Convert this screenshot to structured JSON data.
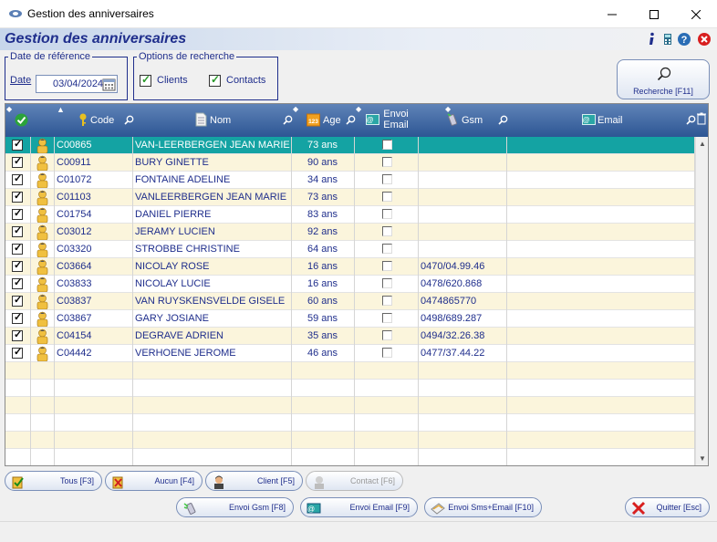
{
  "window": {
    "title": "Gestion des anniversaires"
  },
  "header": {
    "title": "Gestion des anniversaires"
  },
  "reference": {
    "legend": "Date de référence",
    "date_label": "Date",
    "date_value": "03/04/2024"
  },
  "options": {
    "legend": "Options de recherche",
    "clients_label": "Clients",
    "clients_checked": true,
    "contacts_label": "Contacts",
    "contacts_checked": true
  },
  "search_button": {
    "label": "Recherche [F11]"
  },
  "grid": {
    "columns": {
      "code": "Code",
      "nom": "Nom",
      "age": "Age",
      "envoi_email": "Envoi Email",
      "gsm": "Gsm",
      "email": "Email"
    },
    "rows": [
      {
        "checked": true,
        "code": "C00865",
        "nom": "VAN-LEERBERGEN JEAN MARIE",
        "age": "73 ans",
        "gsm": "",
        "email": ""
      },
      {
        "checked": true,
        "code": "C00911",
        "nom": "BURY GINETTE",
        "age": "90 ans",
        "gsm": "",
        "email": ""
      },
      {
        "checked": true,
        "code": "C01072",
        "nom": "FONTAINE ADELINE",
        "age": "34 ans",
        "gsm": "",
        "email": ""
      },
      {
        "checked": true,
        "code": "C01103",
        "nom": "VANLEERBERGEN JEAN MARIE",
        "age": "73 ans",
        "gsm": "",
        "email": ""
      },
      {
        "checked": true,
        "code": "C01754",
        "nom": "DANIEL PIERRE",
        "age": "83 ans",
        "gsm": "",
        "email": ""
      },
      {
        "checked": true,
        "code": "C03012",
        "nom": "JERAMY LUCIEN",
        "age": "92 ans",
        "gsm": "",
        "email": ""
      },
      {
        "checked": true,
        "code": "C03320",
        "nom": "STROBBE CHRISTINE",
        "age": "64 ans",
        "gsm": "",
        "email": ""
      },
      {
        "checked": true,
        "code": "C03664",
        "nom": "NICOLAY ROSE",
        "age": "16 ans",
        "gsm": "0470/04.99.46",
        "email": ""
      },
      {
        "checked": true,
        "code": "C03833",
        "nom": "NICOLAY LUCIE",
        "age": "16 ans",
        "gsm": "0478/620.868",
        "email": ""
      },
      {
        "checked": true,
        "code": "C03837",
        "nom": "VAN RUYSKENSVELDE GISELE",
        "age": "60 ans",
        "gsm": "0474865770",
        "email": ""
      },
      {
        "checked": true,
        "code": "C03867",
        "nom": "GARY JOSIANE",
        "age": "59 ans",
        "gsm": "0498/689.287",
        "email": ""
      },
      {
        "checked": true,
        "code": "C04154",
        "nom": "DEGRAVE ADRIEN",
        "age": "35 ans",
        "gsm": "0494/32.26.38",
        "email": ""
      },
      {
        "checked": true,
        "code": "C04442",
        "nom": "VERHOENE JEROME",
        "age": "46 ans",
        "gsm": "0477/37.44.22",
        "email": ""
      }
    ],
    "selected_row": 0
  },
  "buttons": {
    "tous": "Tous [F3]",
    "aucun": "Aucun [F4]",
    "client": "Client [F5]",
    "contact": "Contact [F6]",
    "envoi_gsm": "Envoi Gsm [F8]",
    "envoi_email": "Envoi Email [F9]",
    "envoi_sms_email": "Envoi Sms+Email [F10]",
    "quitter": "Quitter [Esc]"
  },
  "colors": {
    "accent": "#1f2e8c",
    "grid_header": "#3b64a0",
    "selection": "#14a3a3",
    "row_alt": "#fbf5dc"
  }
}
